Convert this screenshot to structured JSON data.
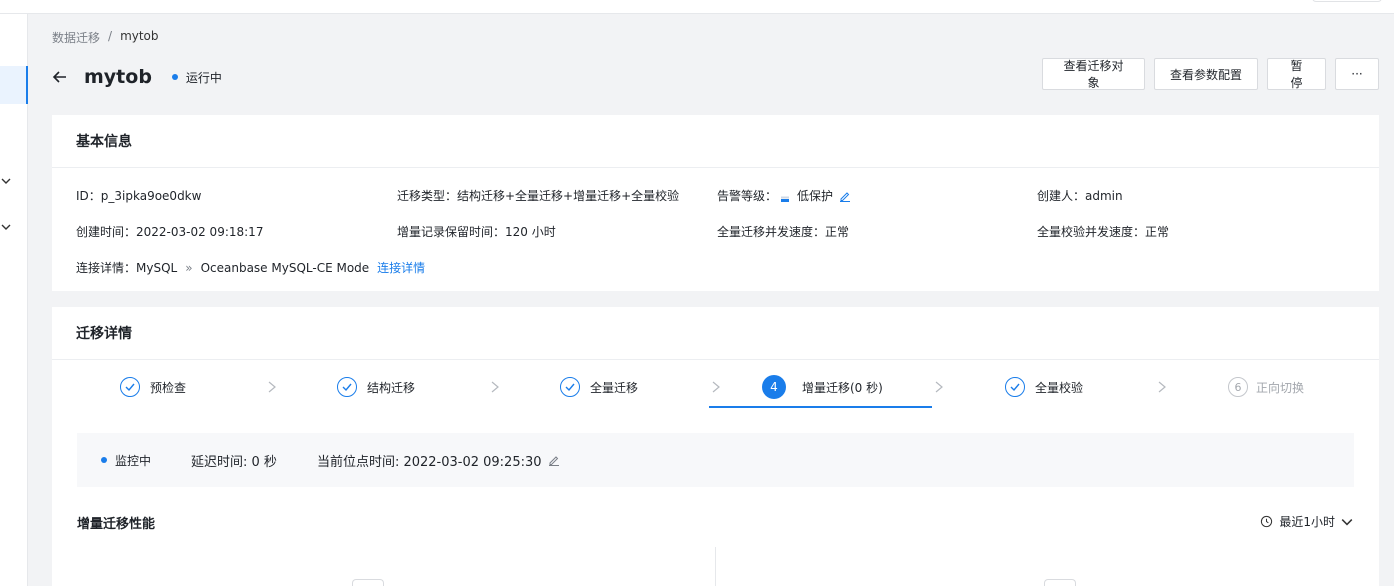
{
  "breadcrumb": {
    "root": "数据迁移",
    "sep": "/",
    "current": "mytob"
  },
  "header": {
    "title": "mytob",
    "status": "运行中"
  },
  "actions": {
    "view_objects": "查看迁移对象",
    "view_params": "查看参数配置",
    "pause": "暂 停",
    "more": "···"
  },
  "basic": {
    "title": "基本信息",
    "id": "ID：p_3ipka9oe0dkw",
    "migrate_type": "迁移类型：结构迁移+全量迁移+增量迁移+全量校验",
    "alert_label": "告警等级：",
    "alert_value": "低保护",
    "creator": "创建人：admin",
    "create_time": "创建时间：2022-03-02 09:18:17",
    "retention": "增量记录保留时间：120 小时",
    "full_speed": "全量迁移并发速度：正常",
    "verify_speed": "全量校验并发速度：正常",
    "conn_label": "连接详情：MySQL",
    "conn_arrow": "»",
    "conn_target": "Oceanbase MySQL-CE Mode",
    "conn_link": "连接详情"
  },
  "migrate": {
    "title": "迁移详情",
    "steps": [
      {
        "label": "预检查"
      },
      {
        "label": "结构迁移"
      },
      {
        "label": "全量迁移"
      },
      {
        "num": "4",
        "label": "增量迁移(0 秒)"
      },
      {
        "label": "全量校验"
      },
      {
        "num": "6",
        "label": "正向切换"
      }
    ],
    "monitor_status": "监控中",
    "delay": "延迟时间: 0 秒",
    "position_time": "当前位点时间: 2022-03-02 09:25:30",
    "perf_title": "增量迁移性能",
    "range": "最近1小时"
  },
  "colors": {
    "accent": "#1a7dea",
    "page_bg": "#f2f3f5"
  }
}
